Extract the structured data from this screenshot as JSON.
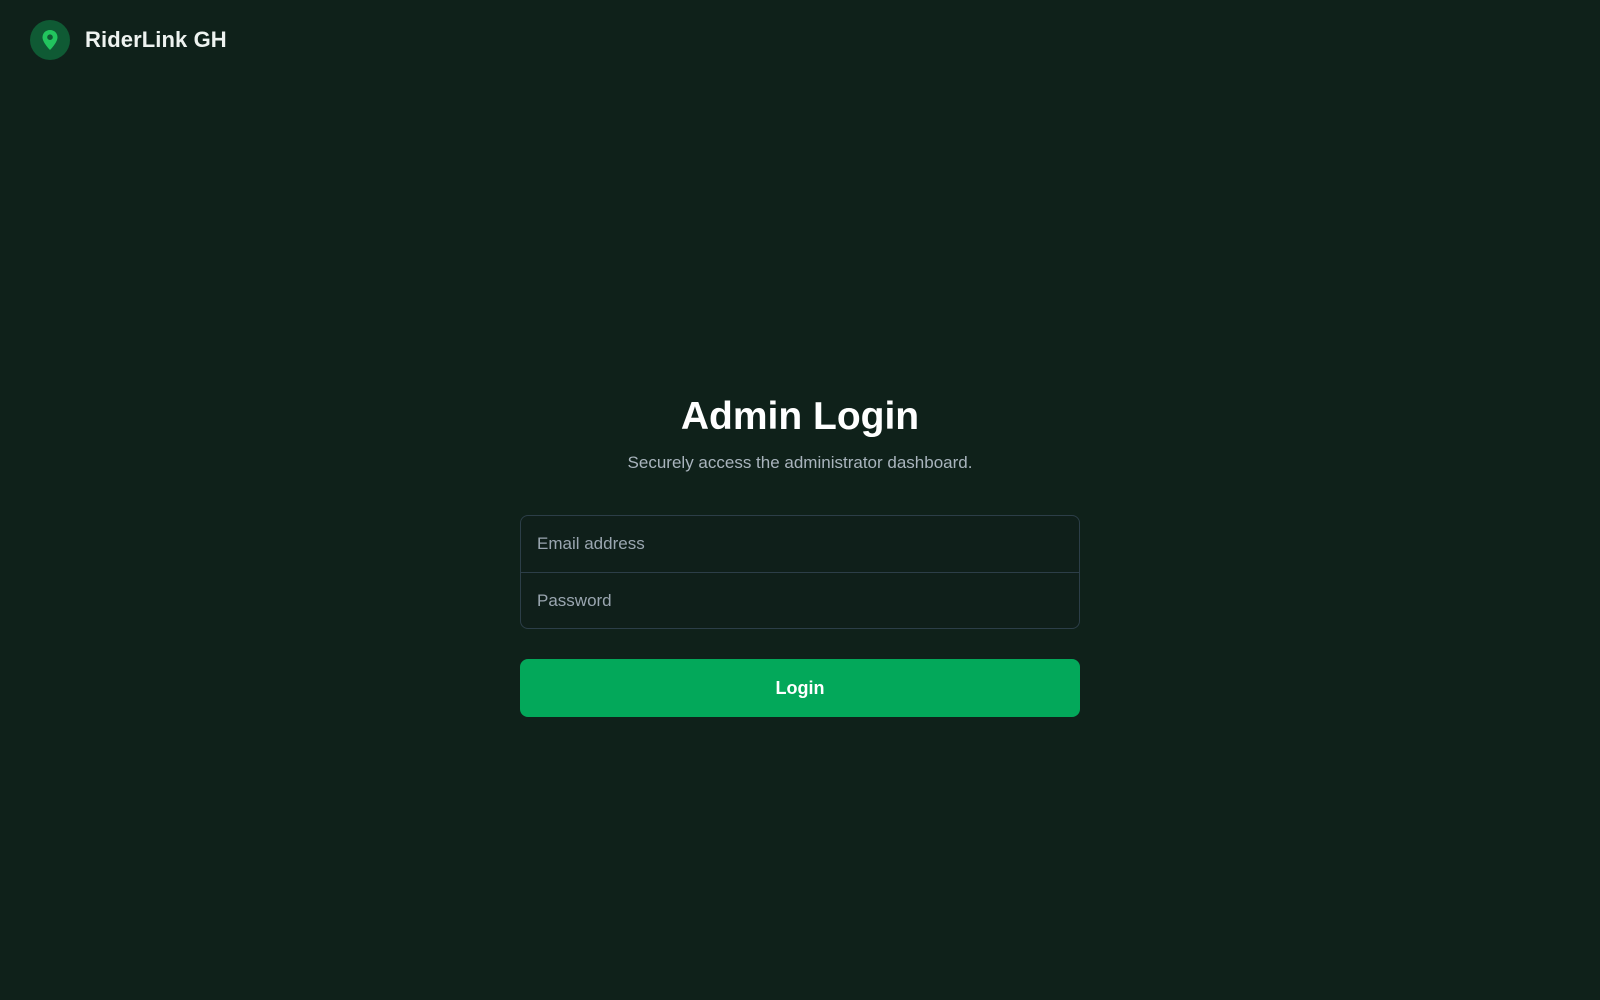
{
  "header": {
    "brand_name": "RiderLink GH",
    "logo_icon": "map-pin-icon"
  },
  "login": {
    "title": "Admin Login",
    "subtitle": "Securely access the administrator dashboard.",
    "email": {
      "value": "",
      "placeholder": "Email address"
    },
    "password": {
      "value": "",
      "placeholder": "Password"
    },
    "submit_label": "Login"
  },
  "colors": {
    "background": "#0f211a",
    "accent": "#03a85a",
    "logo_circle": "#0f5a34",
    "field_border": "#2c3e48",
    "subtitle_text": "#a9b4bd"
  }
}
